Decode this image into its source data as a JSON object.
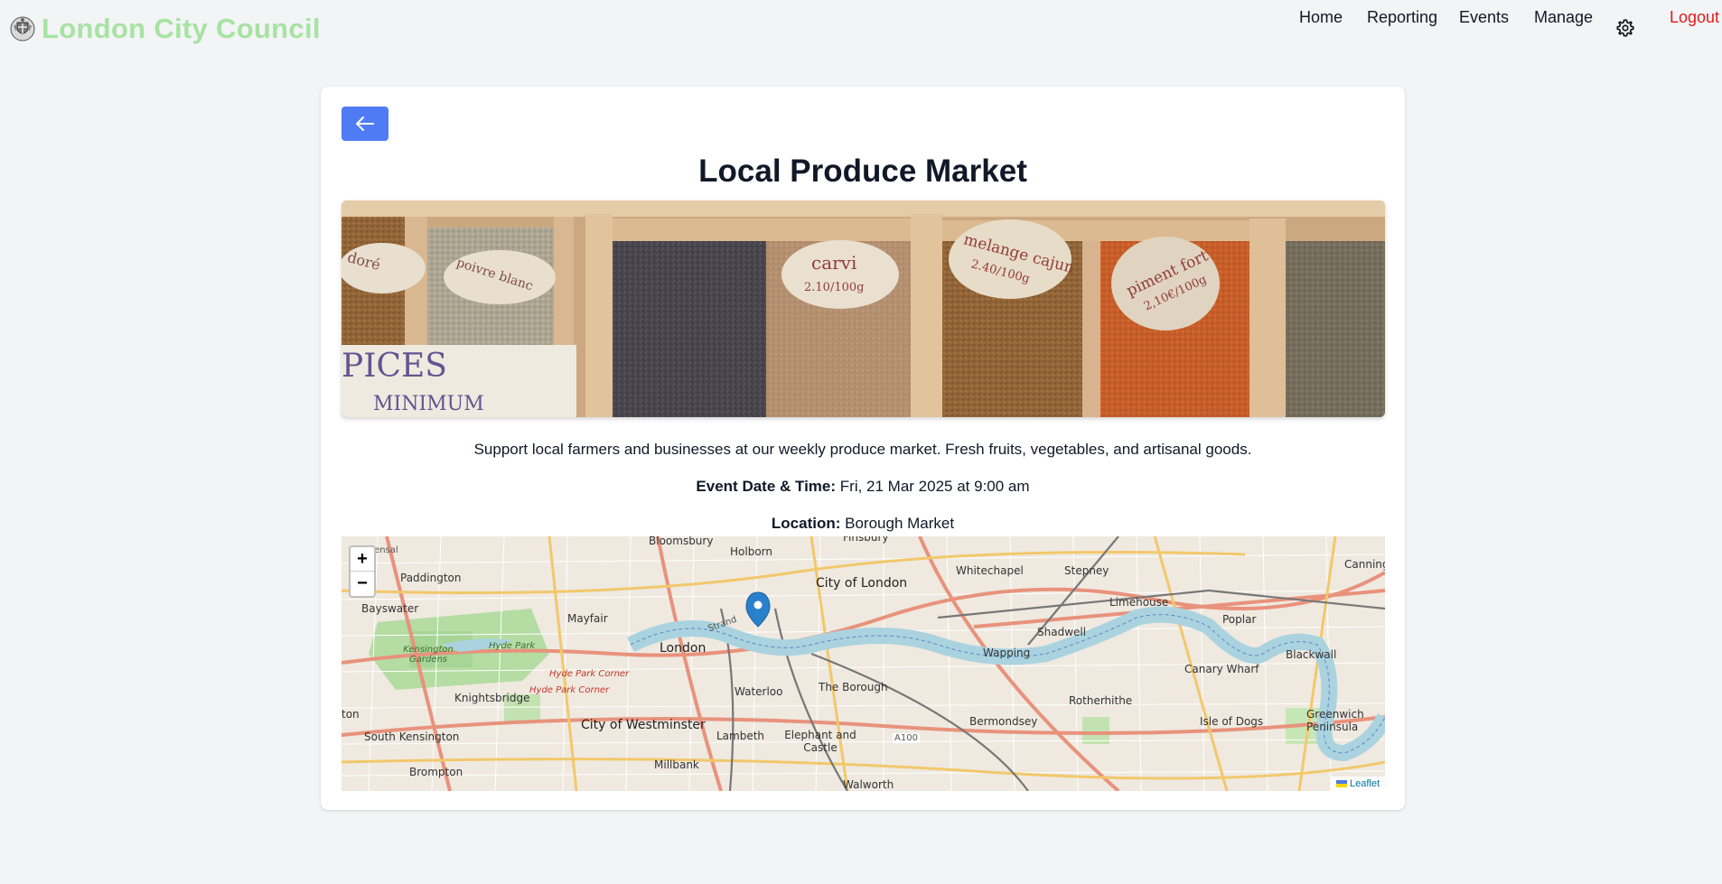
{
  "header": {
    "brand": "London City Council",
    "nav": {
      "home": "Home",
      "reporting": "Reporting",
      "events": "Events",
      "manage": "Manage",
      "logout": "Logout"
    },
    "settings_icon": "gear-icon",
    "logo_icon": "crest-icon"
  },
  "event": {
    "back_icon": "arrow-left-icon",
    "title": "Local Produce Market",
    "description": "Support local farmers and businesses at our weekly produce market. Fresh fruits, vegetables, and artisanal goods.",
    "date_label": "Event Date & Time:",
    "date_value": "Fri, 21 Mar 2025 at 9:00 am",
    "location_label": "Location:",
    "location_value": "Borough Market"
  },
  "hero_image": {
    "sign_spices": "PICES",
    "sign_minimum": "MINIMUM",
    "label_carvi": "carvi",
    "label_carvi_price": "2.10/100g",
    "label_melange": "melange cajun",
    "label_melange_price": "2.40/100g",
    "label_piment": "piment fort",
    "label_piment_price": "2,10€/100g",
    "label_left1": "doré",
    "label_left2": "poivre blanc"
  },
  "map": {
    "zoom_in": "+",
    "zoom_out": "−",
    "attribution": "Leaflet",
    "labels": {
      "bloomsbury": "Bloomsbury",
      "holborn": "Holborn",
      "finsbury": "Finsbury",
      "paddington": "Paddington",
      "city_of_london": "City of London",
      "whitechapel": "Whitechapel",
      "stepney": "Stepney",
      "canning": "Canning",
      "bayswater": "Bayswater",
      "mayfair": "Mayfair",
      "limehouse": "Limehouse",
      "poplar": "Poplar",
      "shadwell": "Shadwell",
      "kensington_gardens": "Kensington Gardens",
      "hyde_park": "Hyde Park",
      "london": "London",
      "wapping": "Wapping",
      "blackwall": "Blackwall",
      "canary_wharf": "Canary Wharf",
      "hyde_park_corner1": "Hyde Park Corner",
      "hyde_park_corner2": "Hyde Park Corner",
      "knightsbridge": "Knightsbridge",
      "waterloo": "Waterloo",
      "the_borough": "The Borough",
      "rotherhithe": "Rotherhithe",
      "kton": "ton",
      "city_of_westminster": "City of Westminster",
      "bermondsey": "Bermondsey",
      "isle_of_dogs": "Isle of Dogs",
      "greenwich_peninsula": "Greenwich Peninsula",
      "south_kensington": "South Kensington",
      "lambeth": "Lambeth",
      "elephant_and_castle": "Elephant and Castle",
      "a100": "A100",
      "millbank": "Millbank",
      "brompton": "Brompton",
      "walworth": "Walworth",
      "kensal": "Kensal",
      "strand": "Strand"
    }
  }
}
